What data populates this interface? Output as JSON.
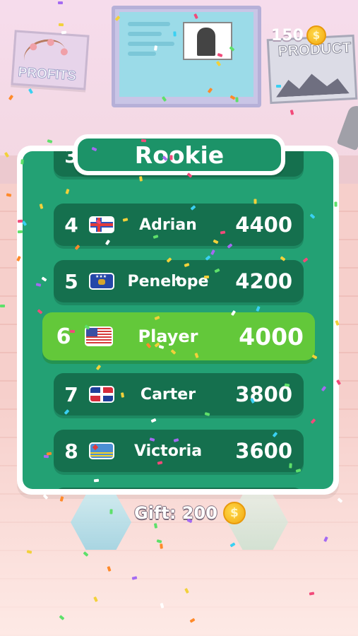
{
  "background": {
    "poster_left_text": "PROFITS",
    "poster_right_text": "PRODUCT"
  },
  "coins": {
    "value": "150",
    "icon": "coin-icon",
    "symbol": "$"
  },
  "leaderboard": {
    "title": "Rookie",
    "partial_top": {
      "rank": "3"
    },
    "rows": [
      {
        "rank": "4",
        "flag": "faroe-islands-flag",
        "name": "Adrian",
        "score": "4400"
      },
      {
        "rank": "5",
        "flag": "kosovo-flag",
        "name": "Penelope",
        "score": "4200"
      },
      {
        "rank": "6",
        "flag": "usa-flag",
        "name": "Player",
        "score": "4000",
        "highlighted": true
      },
      {
        "rank": "7",
        "flag": "dominican-republic-flag",
        "name": "Carter",
        "score": "3800"
      },
      {
        "rank": "8",
        "flag": "aruba-flag",
        "name": "Victoria",
        "score": "3600"
      }
    ],
    "colors": {
      "panel": "#23a174",
      "row": "#15704e",
      "player_row": "#63c83a"
    }
  },
  "gift": {
    "label": "Gift: 200",
    "symbol": "$"
  }
}
